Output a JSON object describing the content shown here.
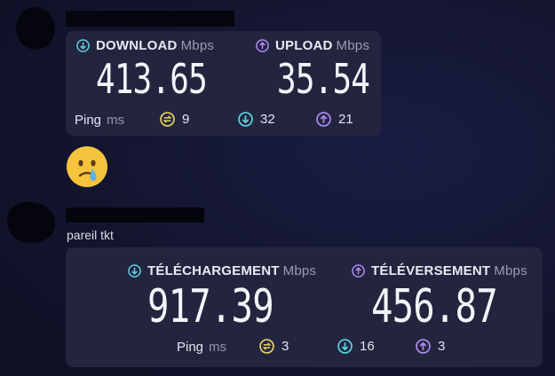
{
  "message1": {
    "card": {
      "download": {
        "label": "DOWNLOAD",
        "unit": "Mbps",
        "value": "413.65"
      },
      "upload": {
        "label": "UPLOAD",
        "unit": "Mbps",
        "value": "35.54"
      },
      "ping": {
        "label": "Ping",
        "unit": "ms",
        "idle": "9",
        "down": "32",
        "up": "21"
      }
    }
  },
  "reaction_emoji": "crying-face",
  "message2": {
    "text": "pareil tkt",
    "card": {
      "download": {
        "label": "TÉLÉCHARGEMENT",
        "unit": "Mbps",
        "value": "917.39"
      },
      "upload": {
        "label": "TÉLÉVERSEMENT",
        "unit": "Mbps",
        "value": "456.87"
      },
      "ping": {
        "label": "Ping",
        "unit": "ms",
        "idle": "3",
        "down": "16",
        "up": "3"
      }
    }
  },
  "colors": {
    "download": "#5fd2e0",
    "upload": "#b48cf2",
    "ping": "#ead16a",
    "card": "#23253f"
  }
}
